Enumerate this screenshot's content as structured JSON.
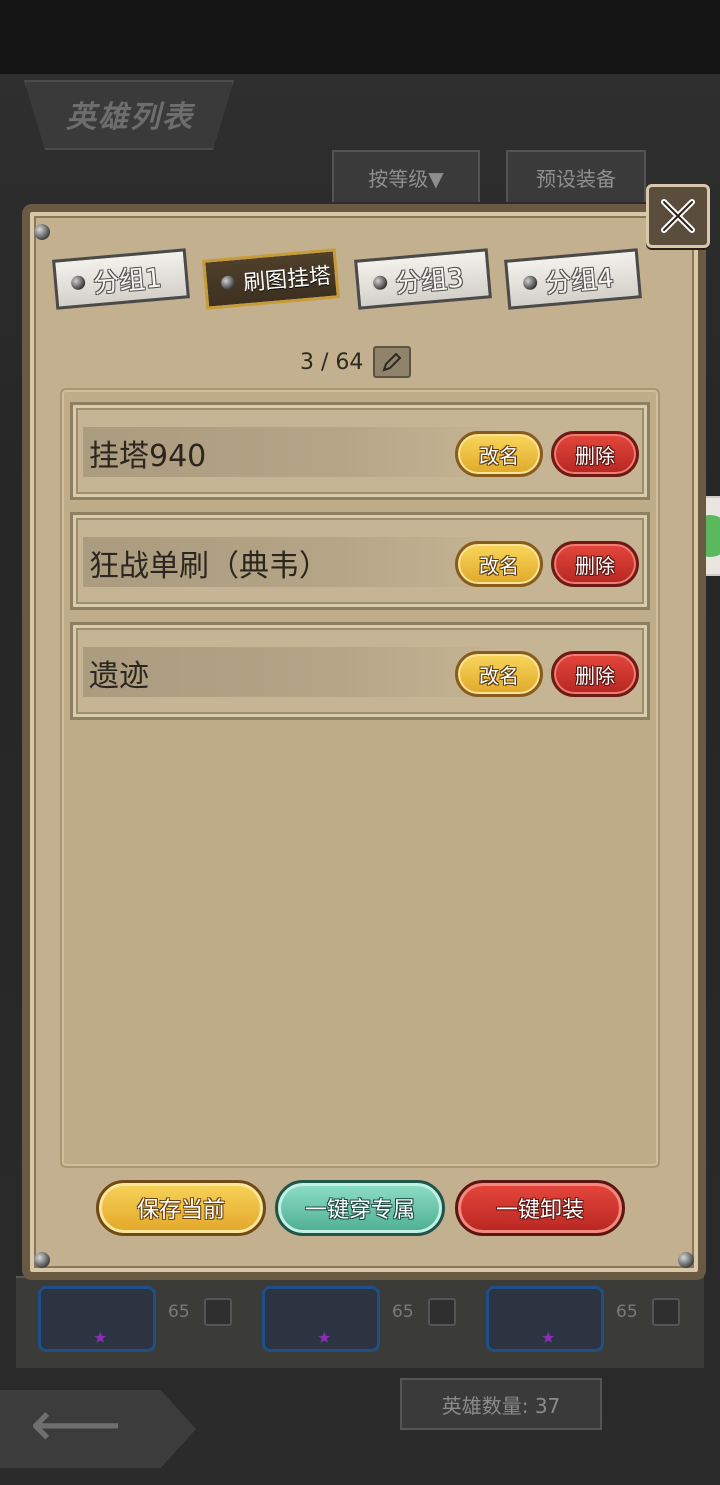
{
  "background": {
    "title": "英雄列表",
    "sort_button": "按等级▼",
    "preset_tab": "预设装备",
    "hero_levels": [
      "65",
      "65",
      "65"
    ],
    "hero_count": "英雄数量: 37"
  },
  "modal": {
    "tabs": [
      {
        "label": "分组1"
      },
      {
        "label": "刷图挂塔"
      },
      {
        "label": "分组3"
      },
      {
        "label": "分组4"
      }
    ],
    "active_tab": "刷图挂塔",
    "counter": "3 / 64",
    "presets": [
      {
        "name": "挂塔940",
        "rename": "改名",
        "delete": "删除"
      },
      {
        "name": "狂战单刷（典韦）",
        "rename": "改名",
        "delete": "删除"
      },
      {
        "name": "遗迹",
        "rename": "改名",
        "delete": "删除"
      }
    ],
    "buttons": {
      "save": "保存当前",
      "equip_exclusive": "一键穿专属",
      "unequip_all": "一键卸装"
    }
  },
  "colors": {
    "panel": "#c3b08e",
    "rename": "#f0c043",
    "delete": "#cc342d",
    "exclusive": "#6cc8ad"
  },
  "icons": {
    "close": "close-crossed-swords-icon",
    "edit": "pencil-edit-icon",
    "back": "back-arrow-icon",
    "side": "wechat-icon"
  }
}
